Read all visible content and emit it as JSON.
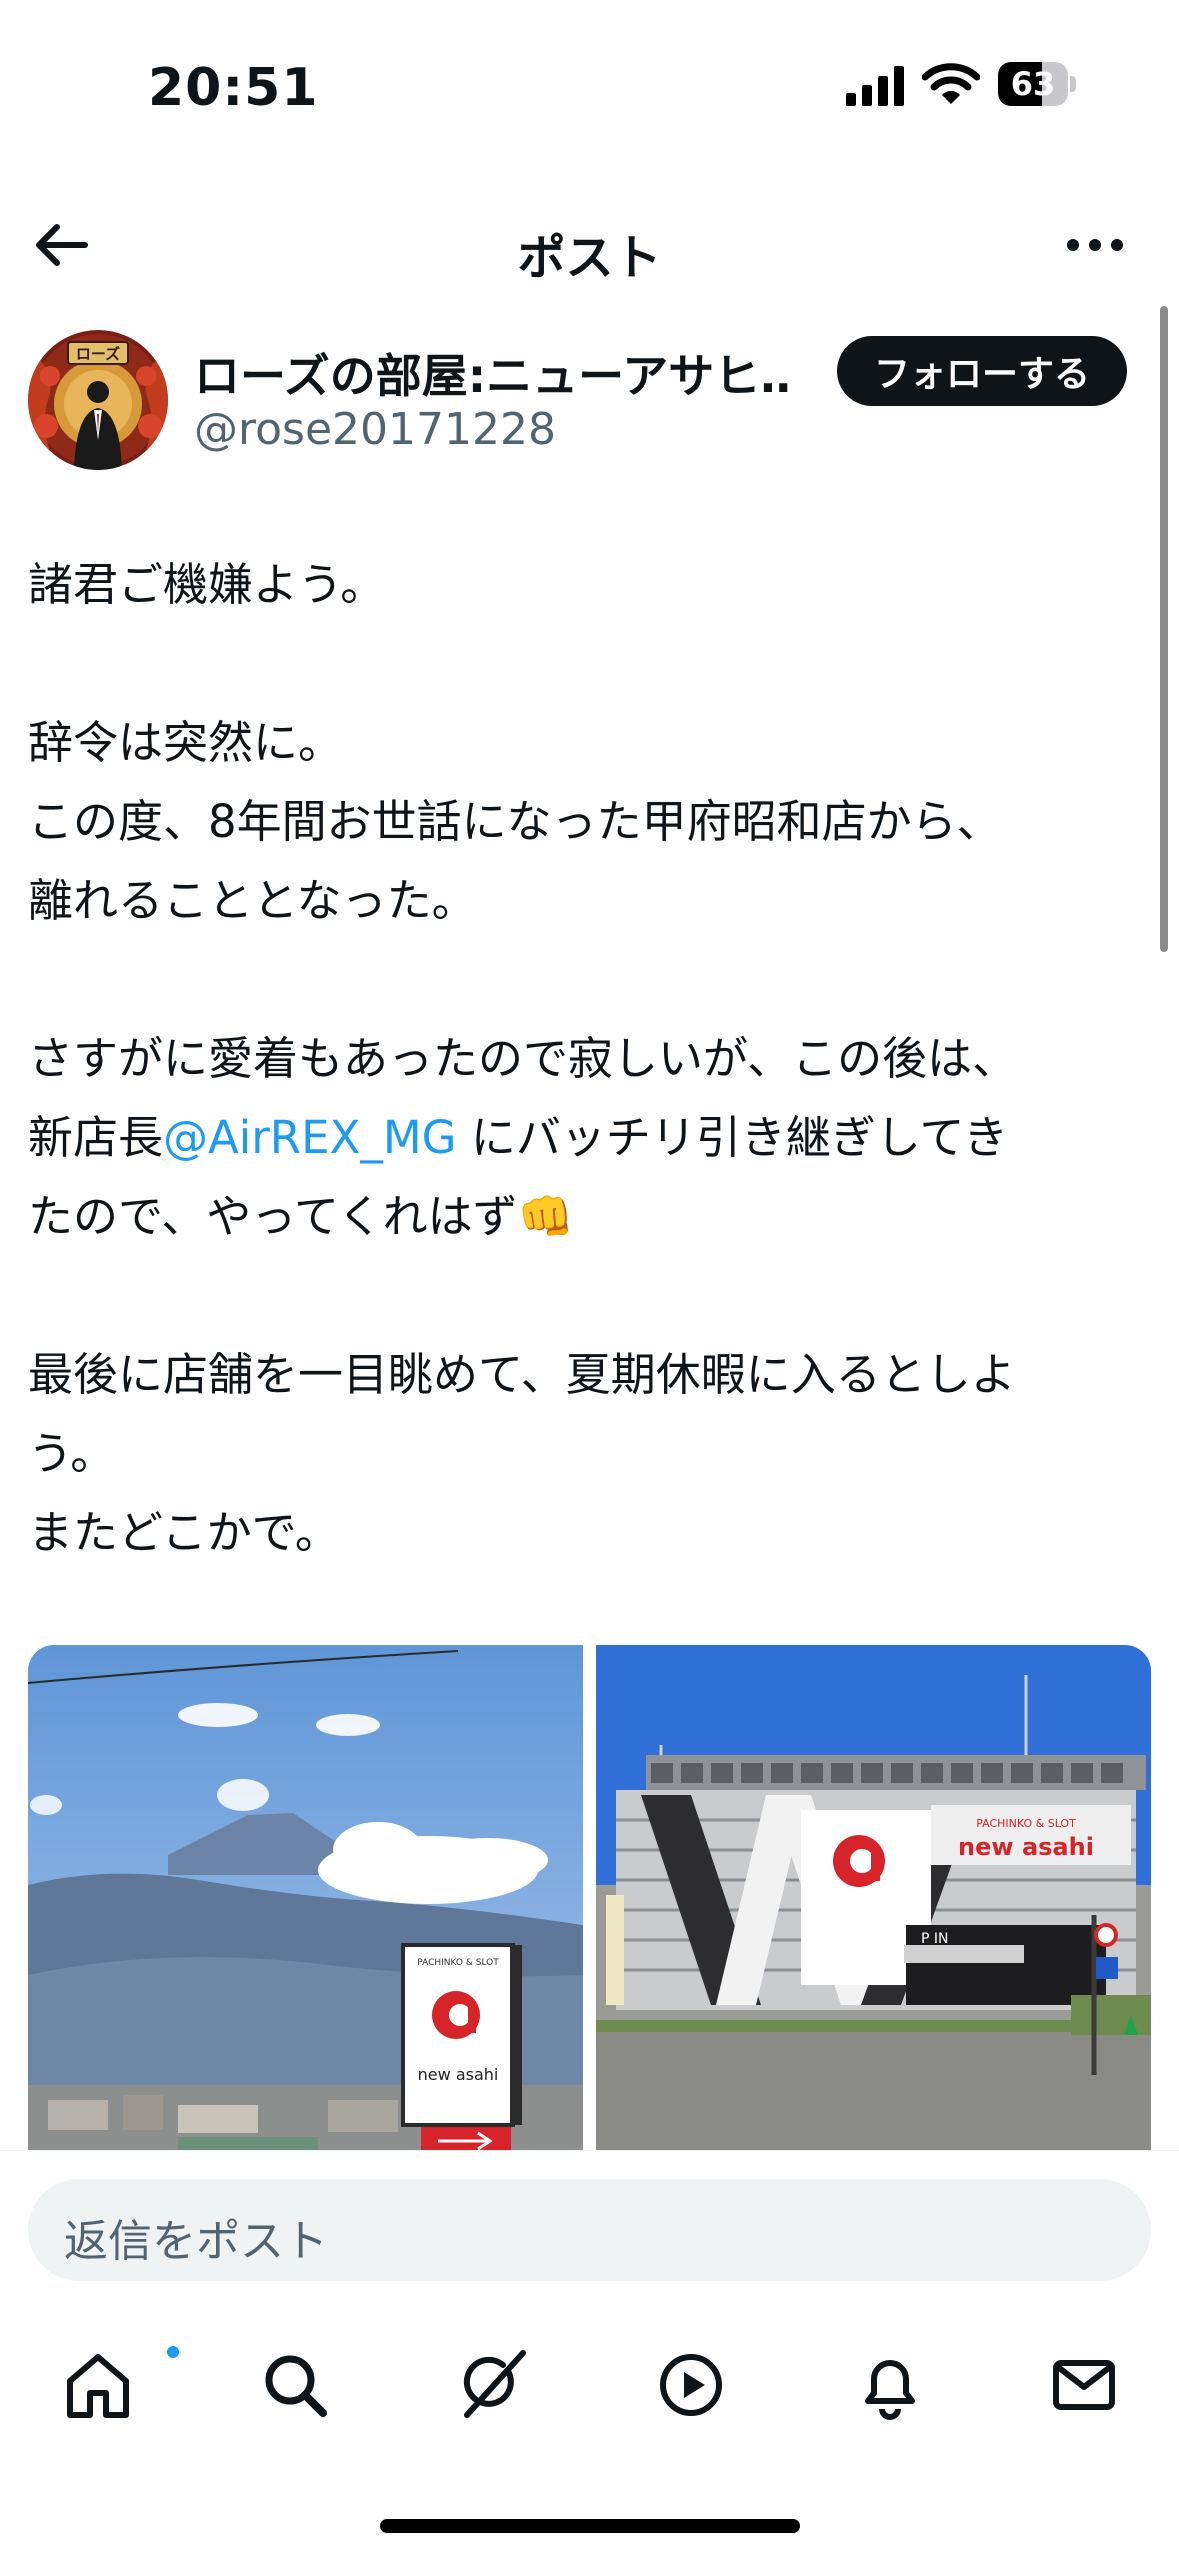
{
  "status_bar": {
    "time": "20:51",
    "battery_level": "63"
  },
  "header": {
    "title": "ポスト",
    "back_icon": "arrow-left-icon",
    "more_icon": "more-horizontal-icon"
  },
  "author": {
    "display_name": "ローズの部屋:ニューアサヒ…",
    "handle": "@rose20171228",
    "avatar_sign_text": "ローズ",
    "follow_label": "フォローする"
  },
  "tweet": {
    "line_1": "諸君ご機嫌よう。",
    "line_2": "辞令は突然に。",
    "line_3": "この度、8年間お世話になった甲府昭和店から、",
    "line_4": "離れることとなった。",
    "line_5": "さすがに愛着もあったので寂しいが、この後は、",
    "line_6_prefix": "新店長",
    "line_6_mention": "@AirREX_MG",
    "line_6_suffix": " にバッチリ引き継ぎしてき",
    "line_7": "たので、やってくれはず👊",
    "line_8": "最後に店舗を一目眺めて、夏期休暇に入るとしよ",
    "line_9": "う。",
    "line_10": "またどこかで。"
  },
  "media": {
    "left_sign_top": "PACHINKO & SLOT",
    "left_sign_brand": "new asahi",
    "right_sign_top": "PACHINKO & SLOT",
    "right_sign_brand": "new asahi",
    "parking_text": "P IN"
  },
  "reply": {
    "placeholder": "返信をポスト"
  },
  "tab_bar": {
    "items": [
      "home-icon",
      "search-icon",
      "grok-icon",
      "video-icon",
      "notifications-icon",
      "messages-icon"
    ],
    "home_badge_color": "#1d9bf0"
  },
  "colors": {
    "text": "#0f1419",
    "secondary": "#536471",
    "link": "#1d9bf0",
    "follow_bg": "#0f1419"
  }
}
